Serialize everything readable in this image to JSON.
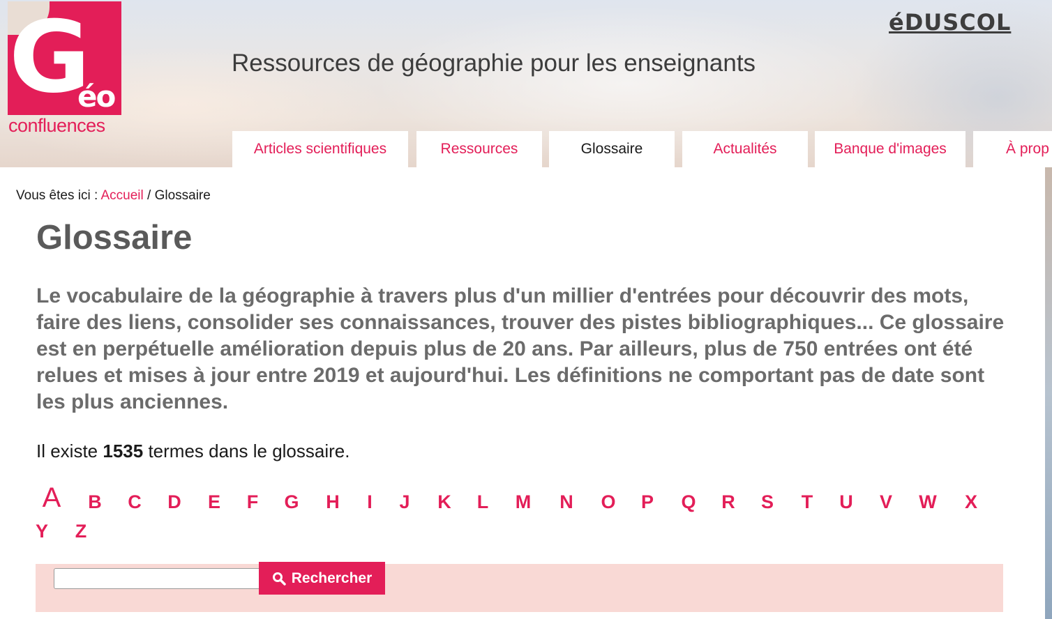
{
  "header": {
    "logo": {
      "letter": "G",
      "accent": "éo",
      "sub": "confluences"
    },
    "tagline": "Ressources de géographie pour les enseignants",
    "partner_logo": "éDUSCOL"
  },
  "nav": {
    "tabs": [
      {
        "label": "Articles scientifiques",
        "active": false
      },
      {
        "label": "Ressources",
        "active": false
      },
      {
        "label": "Glossaire",
        "active": true
      },
      {
        "label": "Actualités",
        "active": false
      },
      {
        "label": "Banque d'images",
        "active": false
      },
      {
        "label": "À prop",
        "active": false
      }
    ]
  },
  "breadcrumb": {
    "prefix": "Vous êtes ici : ",
    "home": "Accueil",
    "separator": " / ",
    "current": "Glossaire"
  },
  "page": {
    "title": "Glossaire",
    "intro": "Le vocabulaire de la géographie à travers plus d'un millier d'entrées pour découvrir des mots, faire des liens, consolider ses connaissances, trouver des pistes bibliographiques... Ce glossaire est en perpétuelle amélioration depuis plus de 20 ans. Par ailleurs, plus de 750 entrées ont été relues et mises à jour entre 2019 et aujourd'hui. Les définitions ne comportant pas de date sont les plus anciennes.",
    "count_prefix": "Il existe ",
    "count": "1535",
    "count_suffix": " termes dans le glossaire."
  },
  "alphabet": {
    "current": "A",
    "letters": [
      "A",
      "B",
      "C",
      "D",
      "E",
      "F",
      "G",
      "H",
      "I",
      "J",
      "K",
      "L",
      "M",
      "N",
      "O",
      "P",
      "Q",
      "R",
      "S",
      "T",
      "U",
      "V",
      "W",
      "X",
      "Y",
      "Z"
    ]
  },
  "search": {
    "input_value": "",
    "button_label": "Rechercher",
    "button_icon": "search-icon"
  },
  "colors": {
    "accent": "#e31e58",
    "search_band": "#f9d9d5",
    "heading": "#5a5a5a",
    "intro_text": "#6b6b6b"
  }
}
